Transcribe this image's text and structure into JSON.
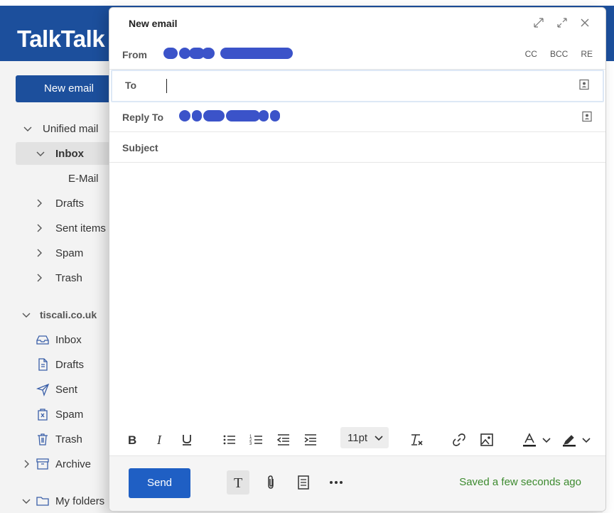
{
  "brand": "TalkTalk",
  "sidebar": {
    "new_email": "New email",
    "unified": "Unified mail",
    "inbox": "Inbox",
    "email_sub": "E-Mail",
    "drafts": "Drafts",
    "sent_items": "Sent items",
    "spam": "Spam",
    "trash": "Trash",
    "account": "tiscali.co.uk",
    "acc_inbox": "Inbox",
    "acc_drafts": "Drafts",
    "acc_sent": "Sent",
    "acc_spam": "Spam",
    "acc_trash": "Trash",
    "acc_archive": "Archive",
    "my_folders": "My folders"
  },
  "composer": {
    "title": "New email",
    "from_label": "From",
    "to_label": "To",
    "replyto_label": "Reply To",
    "subject_label": "Subject",
    "cc": "CC",
    "bcc": "BCC",
    "re": "RE",
    "font_size": "11pt",
    "send": "Send",
    "saved": "Saved a few seconds ago"
  },
  "colors": {
    "brand_blue": "#1c4f9c",
    "send_blue": "#1f5fc4",
    "redaction": "#3b53c9",
    "saved_green": "#3c8a2e"
  }
}
